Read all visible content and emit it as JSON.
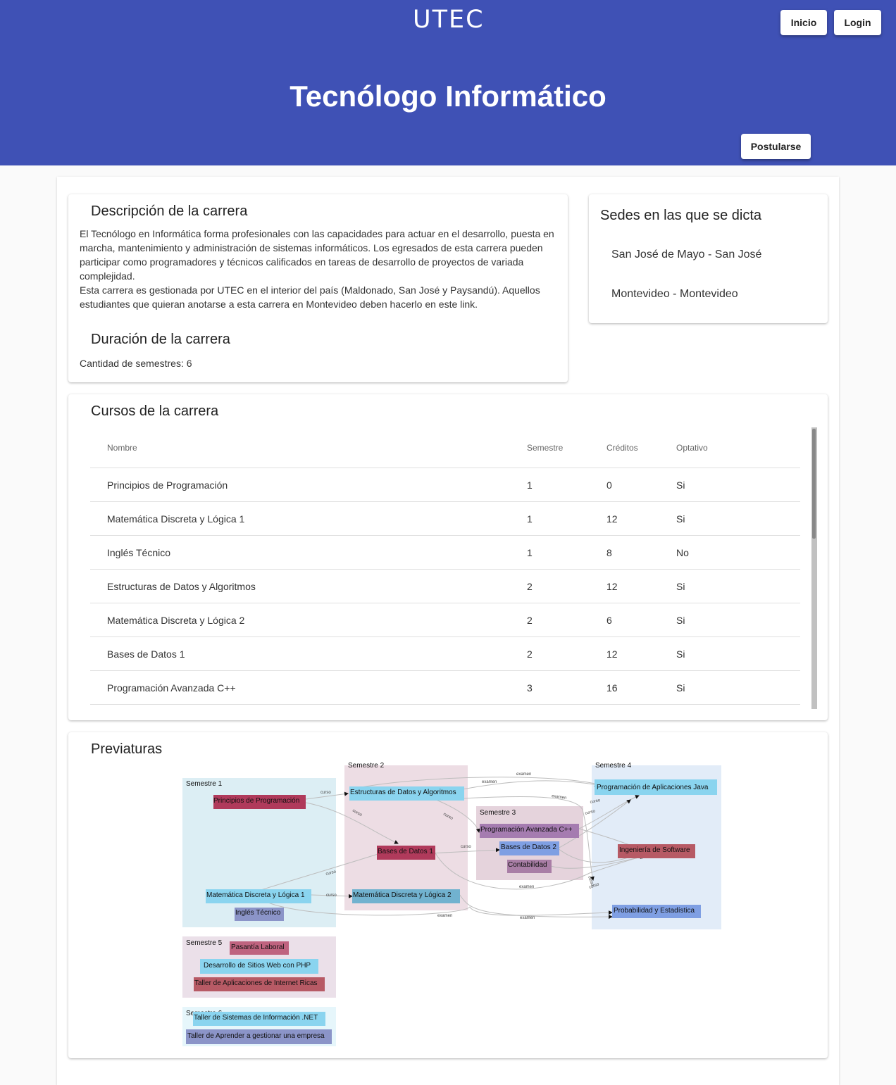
{
  "header": {
    "logo": "UTEC",
    "nav": {
      "inicio": "Inicio",
      "login": "Login"
    },
    "title": "Tecnólogo Informático",
    "postularse": "Postularse"
  },
  "descripcion": {
    "heading": "Descripción de la carrera",
    "p1": "El Tecnólogo en Informática forma profesionales con las capacidades para actuar en el desarrollo, puesta en marcha, mantenimiento y administración de sistemas informáticos. Los egresados de esta carrera pueden participar como programadores y técnicos calificados en tareas de desarrollo de proyectos de variada complejidad.",
    "p2": "Esta carrera es gestionada por UTEC en el interior del país (Maldonado, San José y Paysandú). Aquellos estudiantes que quieran anotarse a esta carrera en Montevideo deben hacerlo en este link."
  },
  "duracion": {
    "heading": "Duración de la carrera",
    "text": "Cantidad de semestres: 6"
  },
  "sedes": {
    "heading": "Sedes en las que se dicta",
    "items": [
      "San José de Mayo - San José",
      "Montevideo - Montevideo"
    ]
  },
  "cursos": {
    "heading": "Cursos de la carrera",
    "columns": [
      "Nombre",
      "Semestre",
      "Créditos",
      "Optativo"
    ],
    "rows": [
      [
        "Principios de Programación",
        "1",
        "0",
        "Si"
      ],
      [
        "Matemática Discreta y Lógica 1",
        "1",
        "12",
        "Si"
      ],
      [
        "Inglés Técnico",
        "1",
        "8",
        "No"
      ],
      [
        "Estructuras de Datos y Algoritmos",
        "2",
        "12",
        "Si"
      ],
      [
        "Matemática Discreta y Lógica 2",
        "2",
        "6",
        "Si"
      ],
      [
        "Bases de Datos 1",
        "2",
        "12",
        "Si"
      ],
      [
        "Programación Avanzada C++",
        "3",
        "16",
        "Si"
      ]
    ]
  },
  "previaturas": {
    "heading": "Previaturas",
    "clusters": [
      "Semestre 1",
      "Semestre 2",
      "Semestre 3",
      "Semestre 4",
      "Semestre 5",
      "Semestre 6"
    ],
    "nodes": [
      "Principios de Programación",
      "Matemática Discreta y Lógica 1",
      "Inglés Técnico",
      "Estructuras de Datos y Algoritmos",
      "Bases de Datos 1",
      "Matemática Discreta y Lógica 2",
      "Programación Avanzada C++",
      "Bases de Datos 2",
      "Contabilidad",
      "Programación de Aplicaciones Java",
      "Ingeniería de Software",
      "Probabilidad y Estadística",
      "Pasantía Laboral",
      "Desarrollo de Sitios Web con PHP",
      "Taller de Aplicaciones de Internet Ricas",
      "Taller de Sistemas de Información .NET",
      "Taller de Aprender a gestionar una empresa"
    ],
    "edge_labels": {
      "curso": "curso",
      "examen": "examen"
    },
    "colors": {
      "s1": "#dceef4",
      "s2": "#eddde4",
      "s3": "#e5d3dc",
      "s4": "#e2ecf8",
      "s5": "#ebe0e9",
      "s6": "#e6f6fb",
      "maroon": "#b03a5b",
      "lightblue": "#8ad4ef",
      "slate": "#8b94c8",
      "steel": "#71b2cf",
      "purple": "#a57cb0",
      "cornflower": "#7f9fe3",
      "mauve": "#a97ea6",
      "brick": "#b75a65"
    }
  }
}
